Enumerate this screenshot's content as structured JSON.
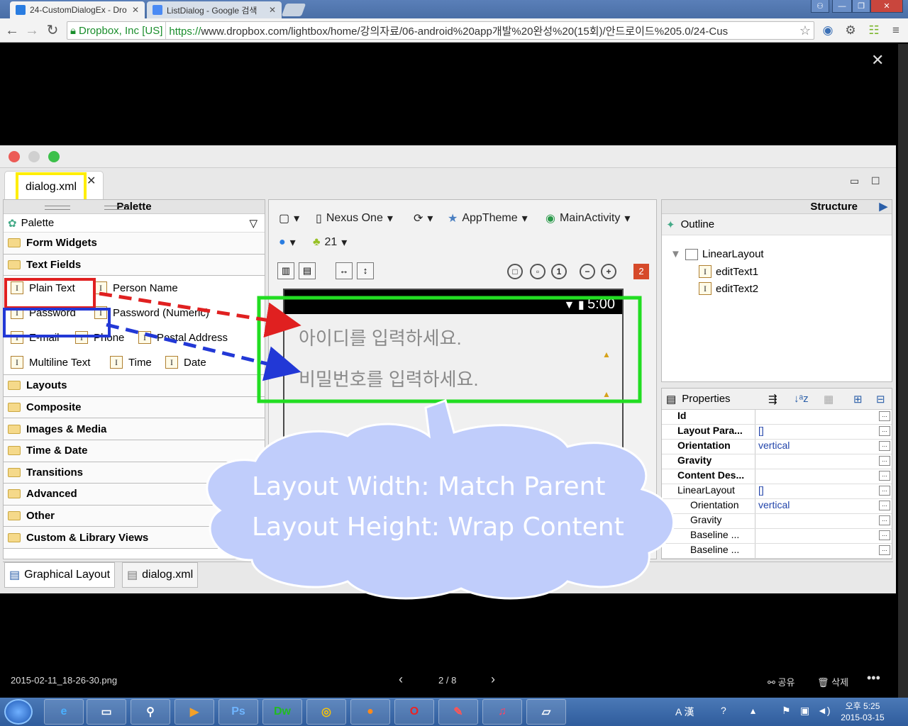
{
  "browser": {
    "tabs": [
      {
        "label": "24-CustomDialogEx - Dro",
        "active": true
      },
      {
        "label": "ListDialog - Google 검색",
        "active": false
      }
    ],
    "ev_label": "Dropbox, Inc [US]",
    "url_scheme": "https://",
    "url_rest": "www.dropbox.com/lightbox/home/강의자료/06-android%20app개발%20완성%20(15회)/안드로이드%205.0/24-Cus"
  },
  "editor": {
    "file_tab": "dialog.xml",
    "palette_title": "Palette",
    "palette_sub": "Palette",
    "categories_top": [
      "Form Widgets",
      "Text Fields"
    ],
    "text_fields": [
      "Plain Text",
      "Person Name",
      "Password",
      "Password (Numeric)",
      "E-mail",
      "Phone",
      "Postal Address",
      "Multiline Text",
      "Time",
      "Date"
    ],
    "categories_bottom": [
      "Layouts",
      "Composite",
      "Images & Media",
      "Time & Date",
      "Transitions",
      "Advanced",
      "Other",
      "Custom & Library Views"
    ],
    "toolbar": {
      "device": "Nexus One",
      "theme": "AppTheme",
      "activity": "MainActivity",
      "api": "21"
    },
    "error_count": "2",
    "status_time": "5:00",
    "hint_id": "아이디를 입력하세요.",
    "hint_pw": "비밀번호를 입력하세요.",
    "structure_title": "Structure",
    "outline_label": "Outline",
    "tree": [
      "LinearLayout",
      "editText1",
      "editText2"
    ],
    "properties_label": "Properties",
    "props": [
      {
        "k": "Id",
        "v": "",
        "style": "bold"
      },
      {
        "k": "Layout Para...",
        "v": "[]",
        "style": "bold"
      },
      {
        "k": "Orientation",
        "v": "vertical",
        "style": "bold"
      },
      {
        "k": "Gravity",
        "v": "",
        "style": "bold"
      },
      {
        "k": "Content Des...",
        "v": "",
        "style": "bold"
      },
      {
        "k": "LinearLayout",
        "v": "[]",
        "style": "plain"
      },
      {
        "k": "Orientation",
        "v": "vertical",
        "style": "indent"
      },
      {
        "k": "Gravity",
        "v": "",
        "style": "indent"
      },
      {
        "k": "Baseline ...",
        "v": "",
        "style": "indent"
      },
      {
        "k": "Baseline ...",
        "v": "",
        "style": "indent"
      }
    ],
    "bottom_tabs": [
      "Graphical Layout",
      "dialog.xml"
    ]
  },
  "annotation": {
    "line1": "Layout Width: Match Parent",
    "line2": "Layout Height: Wrap Content"
  },
  "lightbox": {
    "filename": "2015-02-11_18-26-30.png",
    "counter": "2 / 8",
    "share": "공유",
    "delete": "삭제"
  },
  "taskbar": {
    "apps": [
      "Ps",
      "Dw"
    ],
    "ime": "A 漢",
    "clock_time": "오후 5:25",
    "clock_date": "2015-03-15"
  }
}
